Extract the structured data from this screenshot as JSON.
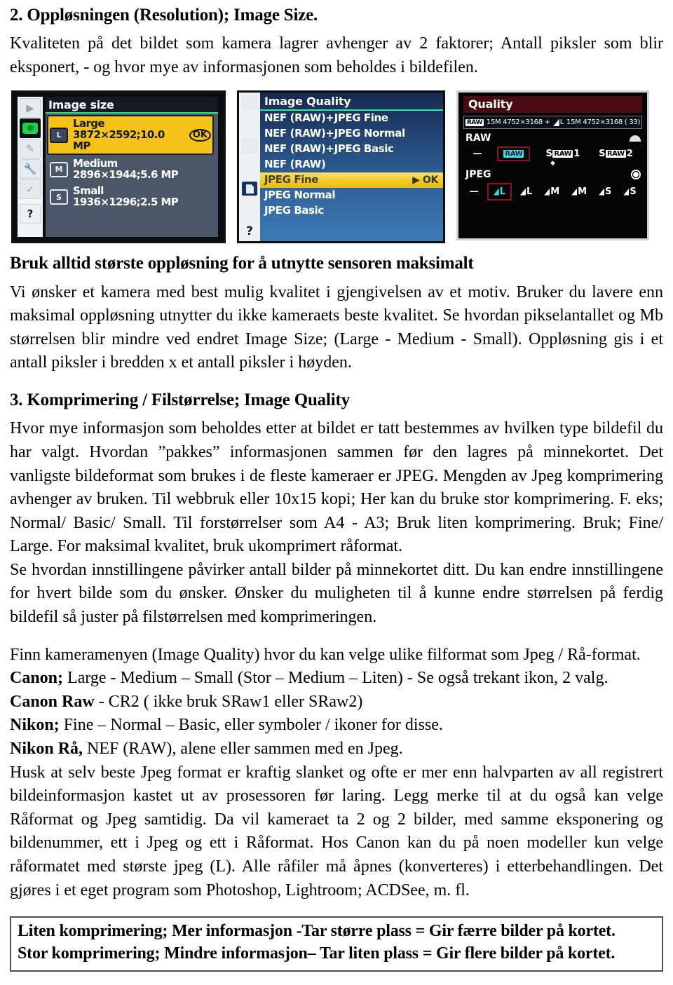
{
  "doc": {
    "section2": {
      "heading": "2. Oppløsningen (Resolution); Image Size.",
      "paragraph": "Kvaliteten på det bildet som kamera lagrer avhenger av 2 faktorer; Antall piksler som blir eksponert, - og hvor mye av informasjonen som beholdes i bildefilen."
    },
    "figures": {
      "nikon_image_size": {
        "title": "Image size",
        "options": [
          {
            "badge": "L",
            "name": "Large",
            "detail": "3872×2592;10.0 MP",
            "selected": true,
            "ok": "OK"
          },
          {
            "badge": "M",
            "name": "Medium",
            "detail": "2896×1944;5.6 MP",
            "selected": false,
            "ok": ""
          },
          {
            "badge": "S",
            "name": "Small",
            "detail": "1936×1296;2.5 MP",
            "selected": false,
            "ok": ""
          }
        ],
        "rail_icons": [
          "playback-icon",
          "shooting-menu-icon",
          "custom-setting-icon",
          "setup-wrench-icon",
          "retouch-icon",
          "help-question-icon"
        ],
        "help_glyph": "?"
      },
      "nikon_image_quality": {
        "title": "Image Quality",
        "items": [
          {
            "label": "NEF (RAW)+JPEG Fine",
            "selected": false,
            "ok": ""
          },
          {
            "label": "NEF (RAW)+JPEG Normal",
            "selected": false,
            "ok": ""
          },
          {
            "label": "NEF (RAW)+JPEG Basic",
            "selected": false,
            "ok": ""
          },
          {
            "label": "NEF (RAW)",
            "selected": false,
            "ok": ""
          },
          {
            "label": "JPEG Fine",
            "selected": true,
            "ok": "▶ OK"
          },
          {
            "label": "JPEG Normal",
            "selected": false,
            "ok": ""
          },
          {
            "label": "JPEG Basic",
            "selected": false,
            "ok": ""
          }
        ],
        "help_glyph": "?"
      },
      "canon_quality": {
        "title": "Quality",
        "info_raw_tag": "RAW",
        "info_left": "15M 4752×3168 +",
        "info_right": "15M 4752×3168 ( 33)",
        "info_jpeg_letter": "L",
        "raw_label": "RAW",
        "raw_options": [
          {
            "text": "—",
            "tag": "",
            "selected": false
          },
          {
            "text": "",
            "tag": "RAW",
            "selected": true
          },
          {
            "text": "S",
            "tag": "RAW",
            "suffix": "1",
            "selected": false
          },
          {
            "text": "S",
            "tag": "RAW",
            "suffix": "2",
            "selected": false
          }
        ],
        "jpeg_label": "JPEG",
        "jpeg_options": [
          {
            "text": "—",
            "wedge": false,
            "selected": false
          },
          {
            "text": "L",
            "wedge": true,
            "selected": true
          },
          {
            "text": "L",
            "wedge": true,
            "selected": false
          },
          {
            "text": "M",
            "wedge": true,
            "selected": false
          },
          {
            "text": "M",
            "wedge": true,
            "selected": false
          },
          {
            "text": "S",
            "wedge": true,
            "selected": false
          },
          {
            "text": "S",
            "wedge": true,
            "selected": false
          }
        ]
      }
    },
    "block_resolution": {
      "heading": "Bruk alltid største oppløsning for å utnytte sensoren maksimalt",
      "paragraph": "Vi ønsker et kamera med best mulig kvalitet i gjengivelsen av et motiv. Bruker du lavere enn maksimal oppløsning utnytter du ikke kameraets beste kvalitet. Se hvordan pikselantallet og Mb størrelsen blir mindre ved endret Image Size; (Large - Medium - Small). Oppløsning gis i et antall piksler i bredden x et antall piksler i høyden."
    },
    "section3": {
      "heading": "3. Komprimering / Filstørrelse; Image Quality",
      "paragraph1": "Hvor mye informasjon som beholdes etter at bildet er tatt bestemmes av hvilken type bildefil du har valgt. Hvordan ”pakkes” informasjonen sammen før den lagres på minnekortet. Det vanligste bildeformat som brukes i de fleste kameraer er JPEG. Mengden av Jpeg komprimering avhenger av bruken. Til webbruk eller 10x15 kopi; Her kan du bruke stor komprimering. F. eks; Normal/ Basic/ Small. Til forstørrelser som A4 - A3; Bruk liten komprimering. Bruk; Fine/ Large. For maksimal kvalitet, bruk ukomprimert råformat.",
      "paragraph2": "Se hvordan innstillingene påvirker antall bilder på minnekortet ditt. Du kan endre innstillingene for hvert bilde som du ønsker. Ønsker du muligheten til å kunne endre størrelsen på ferdig bildefil så juster på filstørrelsen med komprimeringen."
    },
    "camera_list": {
      "intro": "Finn kameramenyen (Image Quality) hvor du kan velge ulike filformat som Jpeg / Rå-format.",
      "canon_label": "Canon;",
      "canon_text": "Large - Medium – Small (Stor – Medium – Liten) - Se også trekant ikon, 2 valg.",
      "canon_raw_label": "Canon Raw",
      "canon_raw_text": "- CR2 ( ikke bruk SRaw1 eller SRaw2)",
      "nikon_label": "Nikon;",
      "nikon_text": "Fine – Normal – Basic, eller symboler / ikoner for disse.",
      "nikon_raw_label": "Nikon Rå,",
      "nikon_raw_text": "NEF (RAW), alene eller sammen med en Jpeg."
    },
    "closing_paragraph": "Husk at selv beste Jpeg format er kraftig slanket og ofte er mer enn halvparten av all registrert bildeinformasjon kastet ut av prosessoren før laring. Legg merke til at du også kan velge Råformat og Jpeg samtidig. Da vil kameraet ta 2 og 2 bilder, med samme eksponering og bildenummer, ett i Jpeg og ett i Råformat. Hos Canon kan du på noen modeller kun velge råformatet med største jpeg (L). Alle råfiler må åpnes (konverteres) i etterbehandlingen. Det gjøres i et eget program som Photoshop, Lightroom; ACDSee, m. fl.",
    "callout": {
      "line1": "Liten komprimering; Mer informasjon -Tar større plass = Gir færre bilder på kortet.",
      "line2": "Stor komprimering; Mindre informasjon– Tar liten plass = Gir flere bilder på kortet."
    }
  }
}
